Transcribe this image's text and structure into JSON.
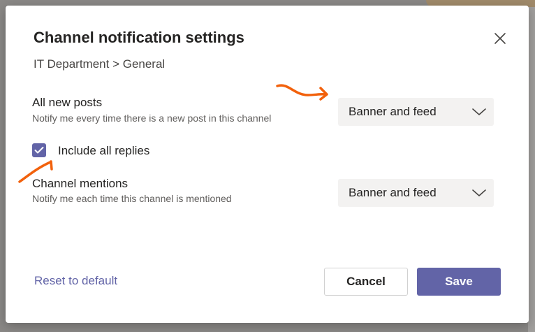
{
  "dialog": {
    "title": "Channel notification settings",
    "breadcrumb": "IT Department > General",
    "close_icon": "close-icon"
  },
  "settings": [
    {
      "title": "All new posts",
      "description": "Notify me every time there is a new post in this channel",
      "selected": "Banner and feed"
    },
    {
      "title": "Channel mentions",
      "description": "Notify me each time this channel is mentioned",
      "selected": "Banner and feed"
    }
  ],
  "include_replies": {
    "label": "Include all replies",
    "checked": true
  },
  "footer": {
    "reset_label": "Reset to default",
    "cancel_label": "Cancel",
    "save_label": "Save"
  },
  "colors": {
    "accent": "#6264a7",
    "annotation": "#f2610c"
  }
}
